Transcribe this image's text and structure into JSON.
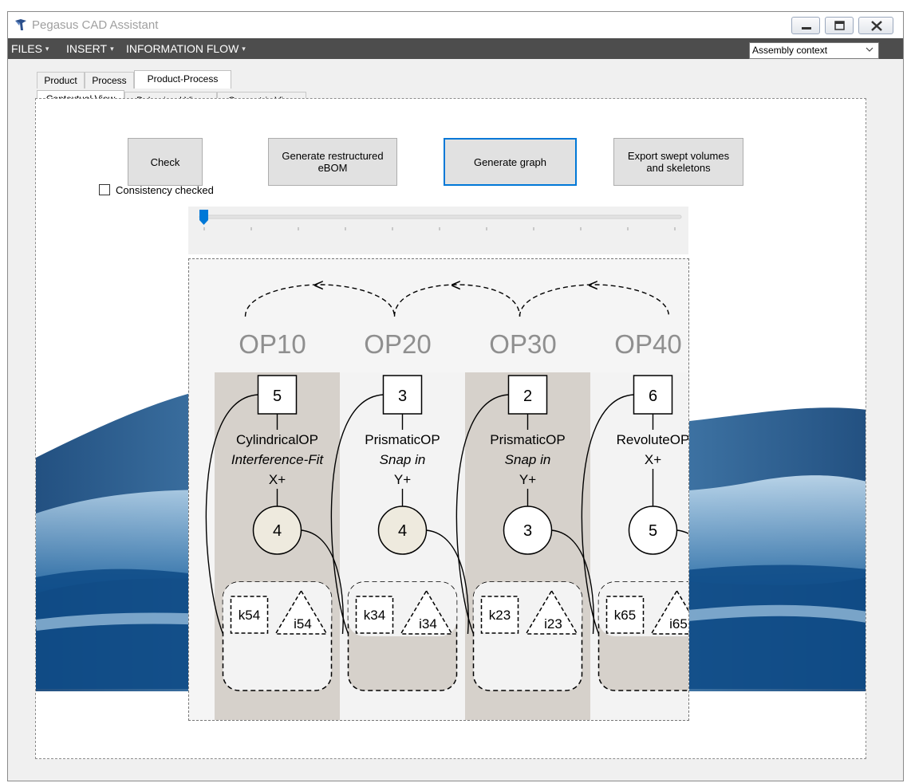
{
  "window": {
    "title": "Pegasus CAD Assistant"
  },
  "menu": {
    "items": [
      {
        "label": "FILES"
      },
      {
        "label": "INSERT"
      },
      {
        "label": "INFORMATION FLOW"
      }
    ],
    "context_select": {
      "value": "Assembly context"
    }
  },
  "top_tabs": [
    {
      "label": "Product"
    },
    {
      "label": "Process"
    },
    {
      "label": "Product-Process",
      "active": true
    }
  ],
  "sub_tabs": [
    {
      "label": "Contextual View",
      "active": true
    },
    {
      "label": "Behavioral View"
    },
    {
      "label": "Geometric View"
    }
  ],
  "actions": {
    "check": "Check",
    "restructure": "Generate restructured eBOM",
    "graph": "Generate graph",
    "export": "Export swept volumes and skeletons"
  },
  "consistency": {
    "label": "Consistency checked",
    "checked": false
  },
  "slider": {
    "value": 0,
    "ticks": 11
  },
  "diagram": {
    "precedence": [
      "<",
      "<",
      "<"
    ],
    "operations": [
      {
        "op": "OP10",
        "part": "5",
        "type": "CylindricalOP",
        "mode": "Interference-Fit",
        "dir": "X+",
        "ref": "4",
        "k": "k54",
        "i": "i54",
        "shaded": true,
        "ref_fill": "#eeeade"
      },
      {
        "op": "OP20",
        "part": "3",
        "type": "PrismaticOP",
        "mode": "Snap in",
        "dir": "Y+",
        "ref": "4",
        "k": "k34",
        "i": "i34",
        "shaded": false,
        "ref_fill": "#eeeade"
      },
      {
        "op": "OP30",
        "part": "2",
        "type": "PrismaticOP",
        "mode": "Snap in",
        "dir": "Y+",
        "ref": "3",
        "k": "k23",
        "i": "i23",
        "shaded": true,
        "ref_fill": "#ffffff"
      },
      {
        "op": "OP40",
        "part": "6",
        "type": "RevoluteOP",
        "mode": "",
        "dir": "X+",
        "ref": "5",
        "k": "k65",
        "i": "i65",
        "shaded": false,
        "ref_fill": "#ffffff"
      }
    ]
  },
  "colors": {
    "menu_bg": "#4d4d4d",
    "accent": "#0078d7",
    "lane_shaded": "#d6d1cb",
    "lane_light": "#f3f3f3"
  }
}
